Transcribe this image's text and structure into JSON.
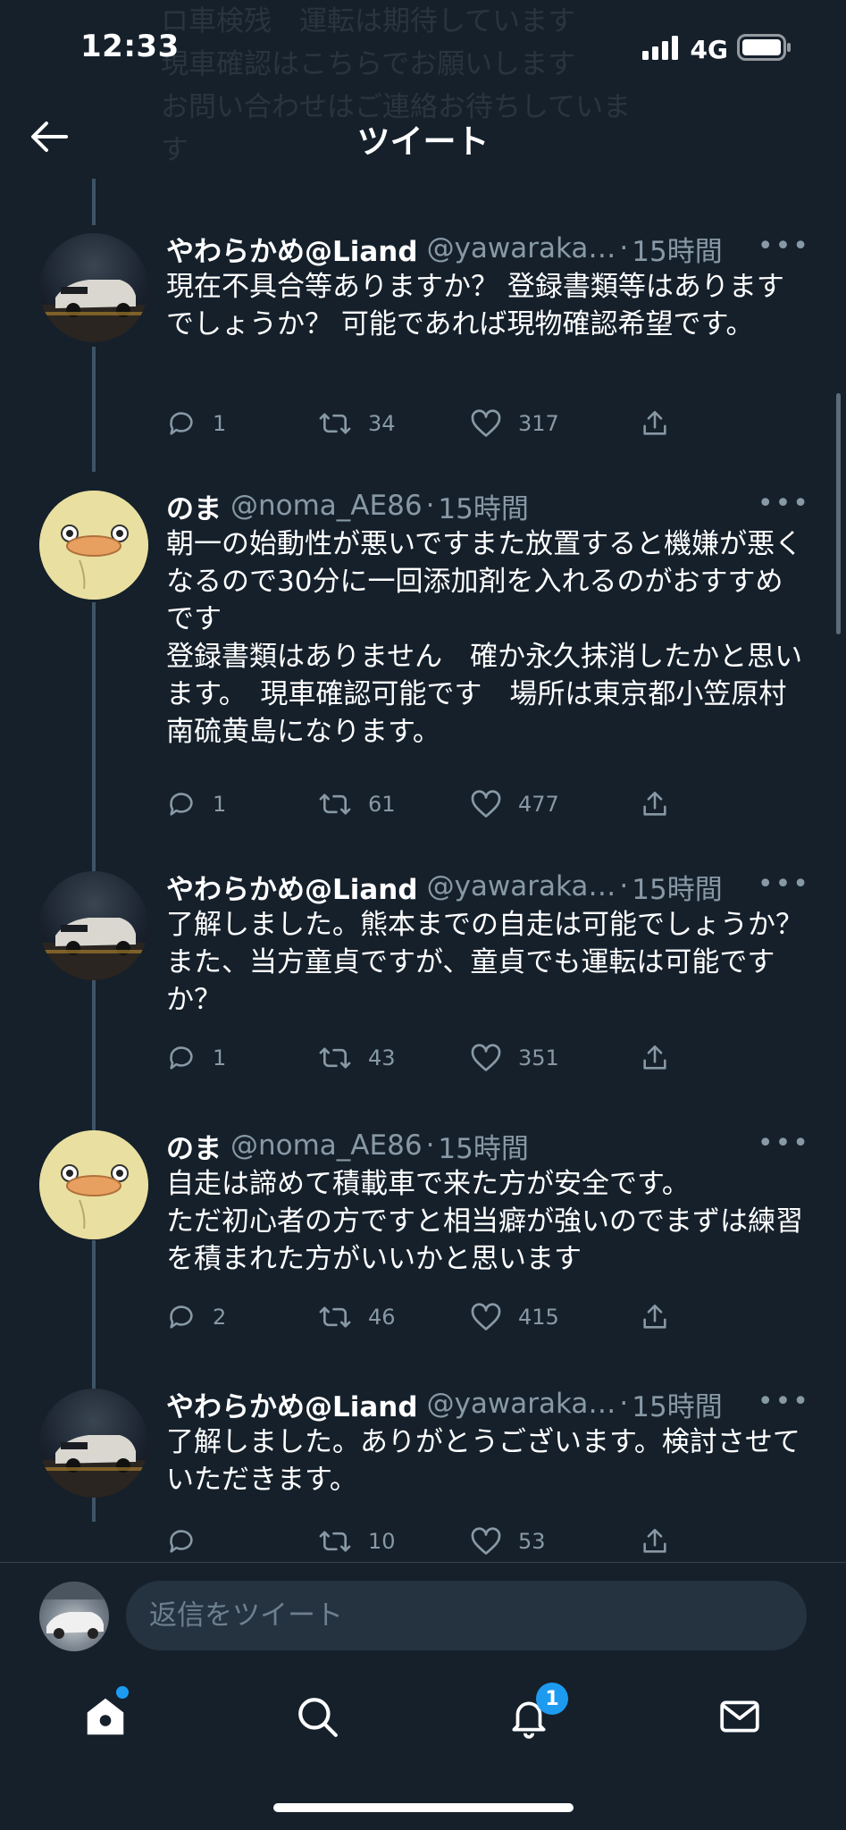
{
  "status_bar": {
    "time": "12:33",
    "carrier": "4G"
  },
  "header": {
    "title": "ツイート"
  },
  "background_faded_text": [
    "ロ車検残　運転は期待しています",
    "現車確認はこちらでお願いします",
    "お問い合わせはご連絡お待ちしています"
  ],
  "tweets": [
    {
      "display_name": "やわらかめ@Liand",
      "handle": "@yawaraka…",
      "time": "15時間",
      "text": "現在不具合等ありますか？ 登録書類等はありますでしょうか？ 可能であれば現物確認希望です。",
      "reply_count": "1",
      "retweet_count": "34",
      "like_count": "317",
      "avatar": "car-photo"
    },
    {
      "display_name": "のま",
      "handle": "@noma_AE86",
      "time": "15時間",
      "text": "朝一の始動性が悪いですまた放置すると機嫌が悪くなるので30分に一回添加剤を入れるのがおすすめです\n登録書類はありません　確か永久抹消したかと思います。　現車確認可能です　場所は東京都小笠原村南硫黄島になります。",
      "reply_count": "1",
      "retweet_count": "61",
      "like_count": "477",
      "avatar": "duck"
    },
    {
      "display_name": "やわらかめ@Liand",
      "handle": "@yawaraka…",
      "time": "15時間",
      "text": "了解しました。熊本までの自走は可能でしょうか？ また、当方童貞ですが、童貞でも運転は可能ですか？",
      "reply_count": "1",
      "retweet_count": "43",
      "like_count": "351",
      "avatar": "car-photo"
    },
    {
      "display_name": "のま",
      "handle": "@noma_AE86",
      "time": "15時間",
      "text": "自走は諦めて積載車で来た方が安全です。\nただ初心者の方ですと相当癖が強いのでまずは練習を積まれた方がいいかと思います",
      "reply_count": "2",
      "retweet_count": "46",
      "like_count": "415",
      "avatar": "duck"
    },
    {
      "display_name": "やわらかめ@Liand",
      "handle": "@yawaraka…",
      "time": "15時間",
      "text": "了解しました。ありがとうございます。検討させていただきます。",
      "reply_count": "",
      "retweet_count": "10",
      "like_count": "53",
      "avatar": "car-photo"
    }
  ],
  "reply": {
    "placeholder": "返信をツイート"
  },
  "tabbar": {
    "items": [
      "home-icon",
      "search-icon",
      "notifications-icon",
      "messages-icon"
    ],
    "notification_badge": "1"
  },
  "colors": {
    "background": "#15202b",
    "secondary_text": "#8899a6",
    "accent": "#1d9bf0",
    "input_bg": "#253341"
  }
}
